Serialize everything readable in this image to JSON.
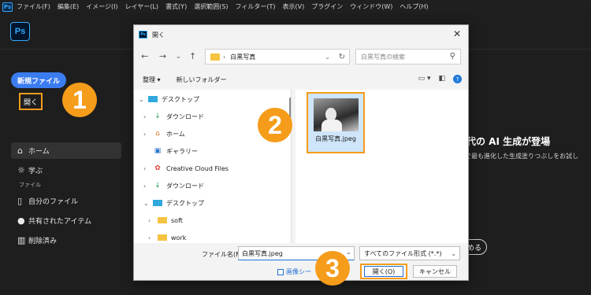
{
  "menubar": {
    "logo": "Ps",
    "items": [
      "ファイル(F)",
      "編集(E)",
      "イメージ(I)",
      "レイヤー(L)",
      "書式(Y)",
      "選択範囲(S)",
      "フィルター(T)",
      "表示(V)",
      "プラグイン",
      "ウィンドウ(W)",
      "ヘルプ(H)"
    ]
  },
  "app": {
    "logo": "Ps"
  },
  "sidebar": {
    "new_file": "新規ファイル",
    "open": "開く",
    "home": "ホーム",
    "learn": "学ぶ",
    "section_files": "ファイル",
    "my_files": "自分のファイル",
    "shared": "共有されたアイテム",
    "deleted": "削除済み"
  },
  "promo": {
    "headline": "代の AI 生成が登場",
    "sub": "で最も進化した生成塗りつぶしをお試し",
    "button": "める"
  },
  "dialog": {
    "title": "開く",
    "close": "✕",
    "path": "白黒写真",
    "search_placeholder": "白黒写真の検索",
    "organize": "整理 ▾",
    "new_folder": "新しいフォルダー",
    "tree": [
      {
        "label": "デスクトップ",
        "icon": "desktop",
        "chev": "⌄"
      },
      {
        "label": "ダウンロード",
        "icon": "download",
        "chev": "›"
      },
      {
        "label": "ホーム",
        "icon": "home",
        "chev": "›"
      },
      {
        "label": "ギャラリー",
        "icon": "gallery",
        "chev": ""
      },
      {
        "label": "Creative Cloud Files",
        "icon": "cc",
        "chev": "›"
      },
      {
        "label": "ダウンロード",
        "icon": "download",
        "chev": "›"
      },
      {
        "label": "デスクトップ",
        "icon": "desktop",
        "chev": "⌄"
      },
      {
        "label": "soft",
        "icon": "folder",
        "chev": "›"
      },
      {
        "label": "work",
        "icon": "folder",
        "chev": "›"
      }
    ],
    "file": {
      "name": "白黒写真.jpeg"
    },
    "filename_label": "ファイル名(N):",
    "filename_value": "白黒写真.jpeg",
    "file_type": "すべてのファイル形式 (*.*)",
    "image_sequence": "画像シー",
    "open_button": "開く(O)",
    "cancel_button": "キャンセル"
  },
  "badges": {
    "one": "1",
    "two": "2",
    "three": "3"
  },
  "colors": {
    "accent_orange": "#f59c1a",
    "ps_blue": "#31a8ff",
    "primary_button": "#3b7df0"
  }
}
